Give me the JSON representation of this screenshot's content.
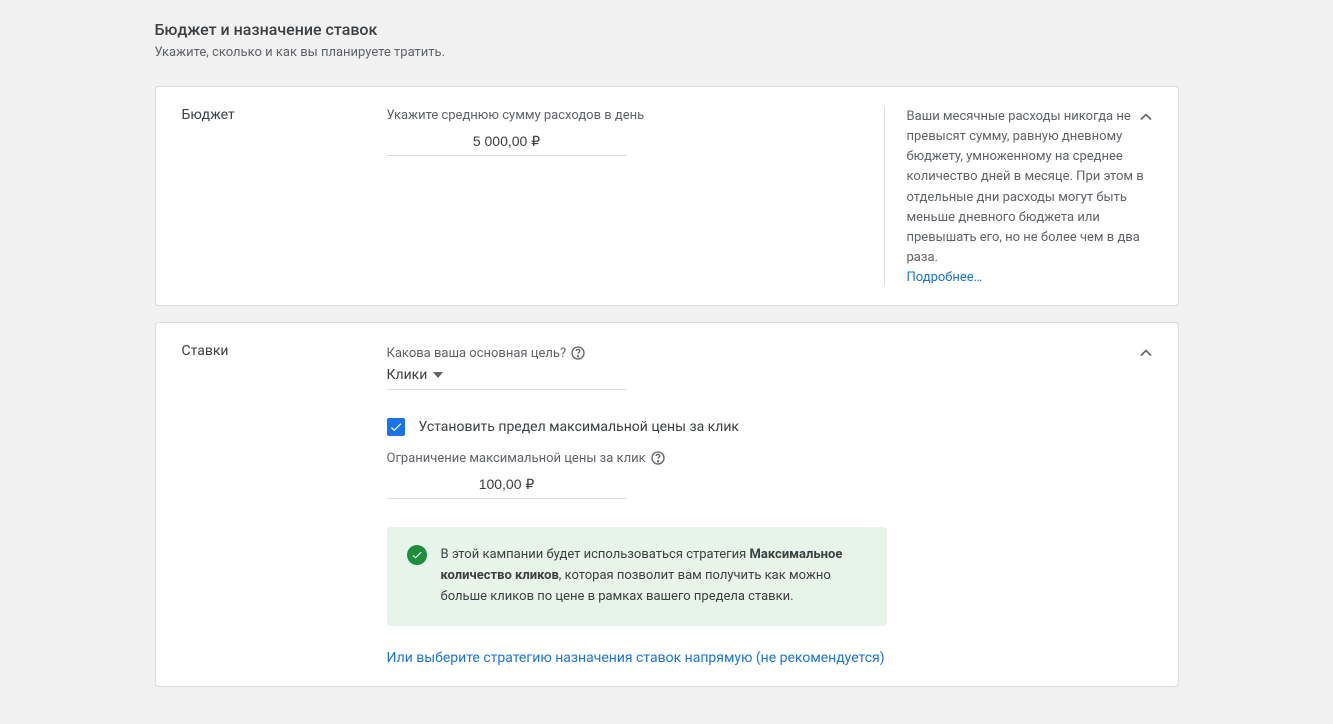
{
  "header": {
    "title": "Бюджет и назначение ставок",
    "subtitle": "Укажите, сколько и как вы планируете тратить."
  },
  "budget": {
    "label": "Бюджет",
    "field_label": "Укажите среднюю сумму расходов в день",
    "value": "5 000,00 ₽",
    "side_text": "Ваши месячные расходы никогда не превысят сумму, равную дневному бюджету, умноженному на среднее количество дней в месяце. При этом в отдельные дни расходы могут быть меньше дневного бюджета или превышать его, но не более чем в два раза.",
    "side_link": "Подробнее…"
  },
  "bids": {
    "label": "Ставки",
    "goal_label": "Какова ваша основная цель?",
    "dropdown_value": "Клики",
    "checkbox_label": "Установить предел максимальной цены за клик",
    "cpc_limit_label": "Ограничение максимальной цены за клик",
    "cpc_value": "100,00 ₽",
    "banner_prefix": "В этой кампании будет использоваться стратегия ",
    "banner_strategy": "Максимальное количество кликов",
    "banner_suffix": ", которая позволит вам получить как можно больше кликов по цене в рамках вашего предела ставки.",
    "alt_link": "Или выберите стратегию назначения ставок напрямую (не рекомендуется)"
  }
}
